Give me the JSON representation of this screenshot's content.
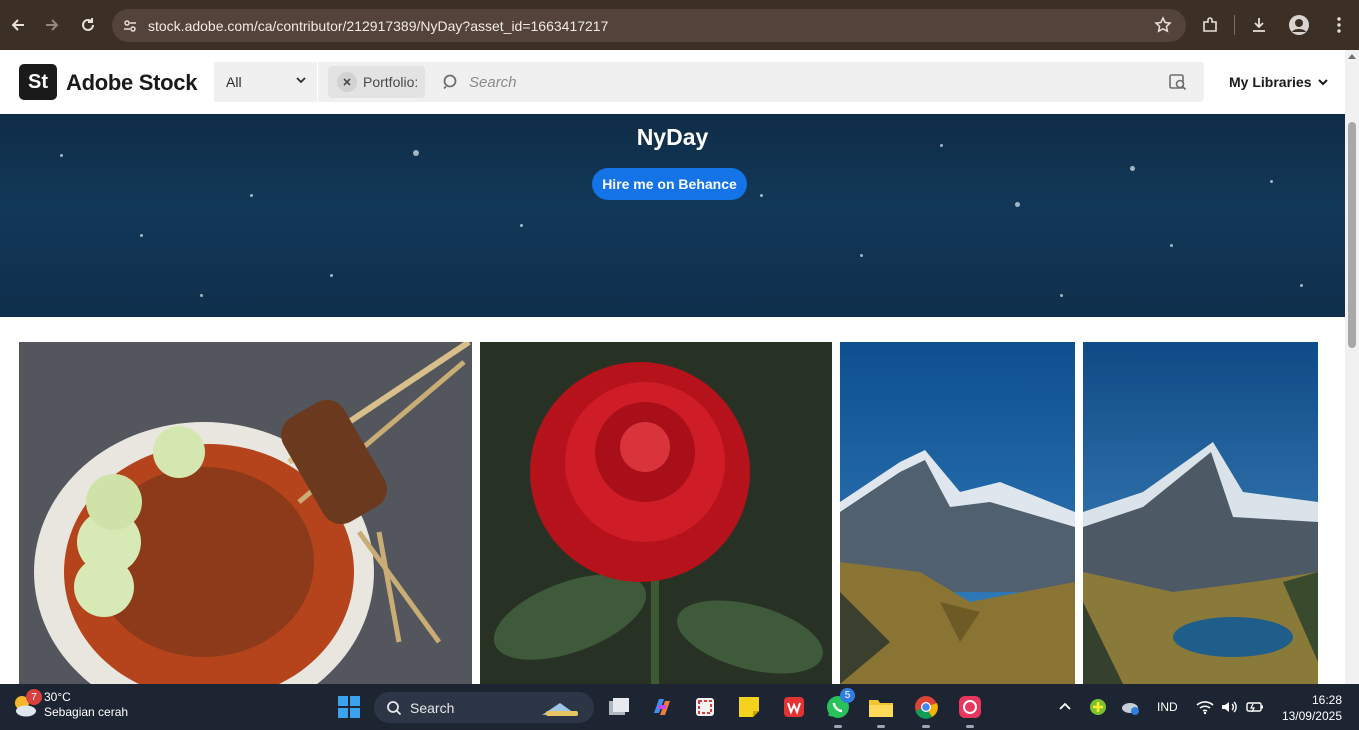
{
  "browser": {
    "url": "stock.adobe.com/ca/contributor/212917389/NyDay?asset_id=1663417217"
  },
  "header": {
    "logo_mark": "St",
    "logo_text": "Adobe Stock",
    "category": "All",
    "chip_label": "Portfolio:",
    "search_placeholder": "Search",
    "libraries_label": "My Libraries"
  },
  "banner": {
    "title": "NyDay",
    "hire_button": "Hire me on Behance"
  },
  "gallery": [
    {
      "subject": "satay-and-curry-bowl"
    },
    {
      "subject": "red-rose"
    },
    {
      "subject": "snowy-mountain-valley"
    },
    {
      "subject": "mountain-lake"
    }
  ],
  "taskbar": {
    "weather_badge": "7",
    "temperature": "30°C",
    "weather_text": "Sebagian cerah",
    "search_label": "Search",
    "whatsapp_badge": "5",
    "language": "IND",
    "time": "16:28",
    "date": "13/09/2025"
  },
  "colors": {
    "browser_bar": "#3c2f25",
    "accent_blue": "#1473e6",
    "banner_bg": "#123858",
    "taskbar": "#1d2533"
  }
}
